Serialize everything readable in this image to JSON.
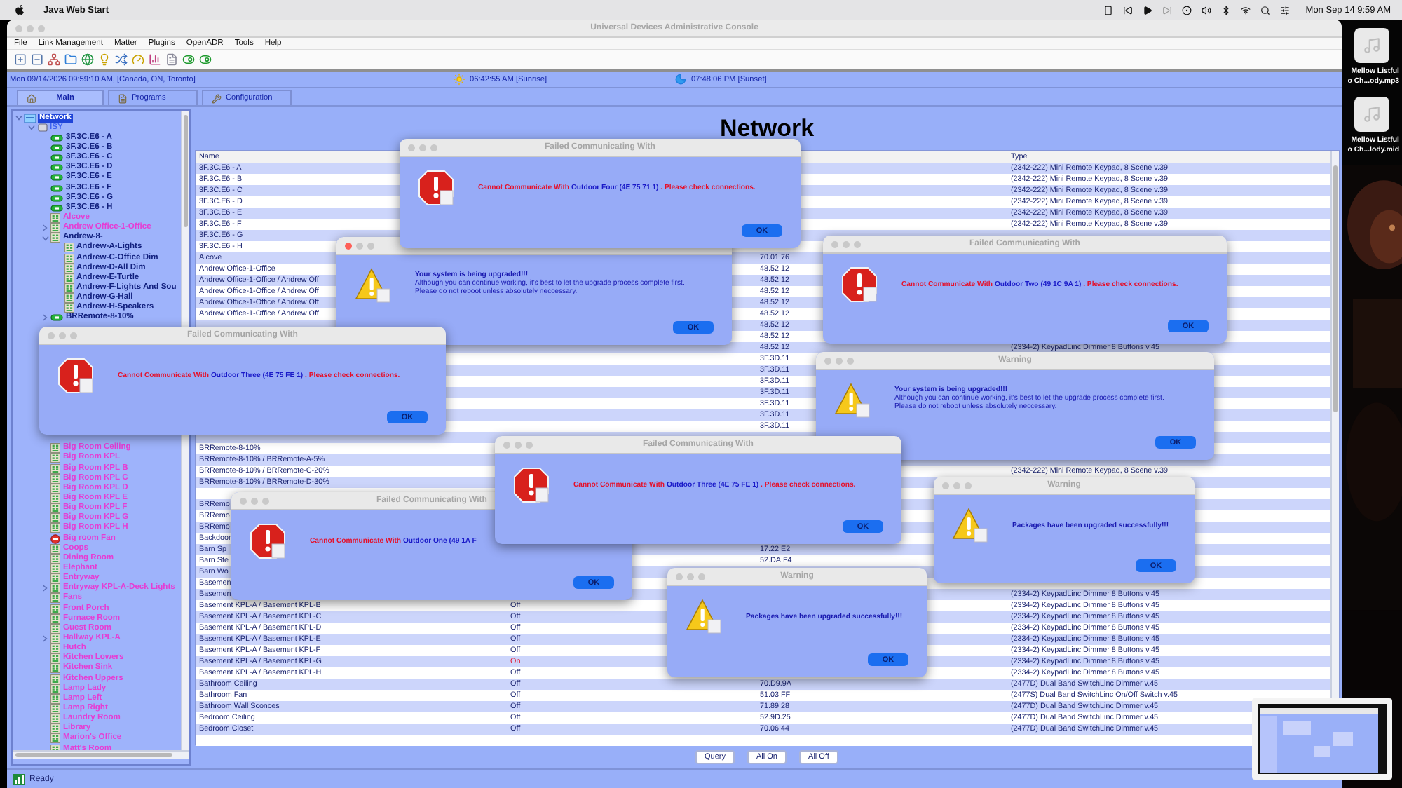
{
  "mac_menu_bar": {
    "app": "Java Web Start",
    "clock": "Mon Sep 14  9:59 AM"
  },
  "window": {
    "title": "Universal Devices Administrative Console"
  },
  "menu": [
    "File",
    "Link Management",
    "Matter",
    "Plugins",
    "OpenADR",
    "Tools",
    "Help"
  ],
  "info_bar": {
    "date": "Mon 09/14/2026 09:59:10 AM,  [Canada, ON, Toronto]",
    "sunrise": "06:42:55 AM [Sunrise]",
    "sunset": "07:48:06 PM [Sunset]"
  },
  "tabs": [
    {
      "label": "Main",
      "selected": true
    },
    {
      "label": "Programs",
      "selected": false
    },
    {
      "label": "Configuration",
      "selected": false
    }
  ],
  "sidebar": {
    "tree": [
      {
        "label": "Network",
        "kind": "network",
        "selected": true,
        "expanded": true,
        "children": [
          {
            "label": "ISY",
            "kind": "controller",
            "color": "#3f63f2",
            "selected": false,
            "expanded": true,
            "children": [
              {
                "label": "3F.3C.E6 - A",
                "kind": "remote",
                "color": "#12207e",
                "selected": false
              },
              {
                "label": "3F.3C.E6 - B",
                "kind": "remote",
                "color": "#12207e",
                "selected": false
              },
              {
                "label": "3F.3C.E6 - C",
                "kind": "remote",
                "color": "#12207e",
                "selected": false
              },
              {
                "label": "3F.3C.E6 - D",
                "kind": "remote",
                "color": "#12207e",
                "selected": false
              },
              {
                "label": "3F.3C.E6 - E",
                "kind": "remote",
                "color": "#12207e",
                "selected": false
              },
              {
                "label": "3F.3C.E6 - F",
                "kind": "remote",
                "color": "#12207e",
                "selected": false
              },
              {
                "label": "3F.3C.E6 - G",
                "kind": "remote",
                "color": "#12207e",
                "selected": false
              },
              {
                "label": "3F.3C.E6 - H",
                "kind": "remote",
                "color": "#12207e",
                "selected": false
              },
              {
                "label": "Alcove",
                "kind": "keypad",
                "color": "#e63cd4",
                "selected": false
              },
              {
                "label": "Andrew Office-1-Office",
                "kind": "keypad",
                "color": "#e63cd4",
                "selected": false,
                "expanded": false
              },
              {
                "label": "Andrew-8-",
                "kind": "keypad",
                "color": "#12207e",
                "selected": false,
                "expanded": true,
                "children": [
                  {
                    "label": "Andrew-A-Lights",
                    "kind": "keypad",
                    "color": "#12207e",
                    "selected": false
                  },
                  {
                    "label": "Andrew-C-Office Dim",
                    "kind": "keypad",
                    "color": "#12207e",
                    "selected": false
                  },
                  {
                    "label": "Andrew-D-All Dim",
                    "kind": "keypad",
                    "color": "#12207e",
                    "selected": false
                  },
                  {
                    "label": "Andrew-E-Turtle",
                    "kind": "keypad",
                    "color": "#12207e",
                    "selected": false
                  },
                  {
                    "label": "Andrew-F-Lights And Sou",
                    "kind": "keypad",
                    "color": "#12207e",
                    "selected": false
                  },
                  {
                    "label": "Andrew-G-Hall",
                    "kind": "keypad",
                    "color": "#12207e",
                    "selected": false
                  },
                  {
                    "label": "Andrew-H-Speakers",
                    "kind": "keypad",
                    "color": "#12207e",
                    "selected": false
                  }
                ]
              },
              {
                "label": "BRRemote-8-10%",
                "kind": "remote",
                "color": "#12207e",
                "selected": false,
                "expanded": false
              }
            ]
          }
        ]
      }
    ],
    "tree_continued": [
      {
        "label": "Big Room Ceiling",
        "kind": "keypad",
        "color": "#e63cd4",
        "selected": false
      },
      {
        "label": "Big Room KPL",
        "kind": "keypad",
        "color": "#e63cd4",
        "selected": false
      },
      {
        "label": "Big Room KPL B",
        "kind": "keypad",
        "color": "#e63cd4",
        "selected": false
      },
      {
        "label": "Big Room KPL C",
        "kind": "keypad",
        "color": "#e63cd4",
        "selected": false
      },
      {
        "label": "Big Room KPL D",
        "kind": "keypad",
        "color": "#e63cd4",
        "selected": false
      },
      {
        "label": "Big Room KPL E",
        "kind": "keypad",
        "color": "#e63cd4",
        "selected": false
      },
      {
        "label": "Big Room KPL F",
        "kind": "keypad",
        "color": "#e63cd4",
        "selected": false
      },
      {
        "label": "Big Room KPL G",
        "kind": "keypad",
        "color": "#e63cd4",
        "selected": false
      },
      {
        "label": "Big Room KPL H",
        "kind": "keypad",
        "color": "#e63cd4",
        "selected": false
      },
      {
        "label": "Big room Fan",
        "kind": "fault",
        "color": "#e63cd4",
        "selected": false
      },
      {
        "label": "Coops",
        "kind": "keypad",
        "color": "#e63cd4",
        "selected": false
      },
      {
        "label": "Dining Room",
        "kind": "keypad",
        "color": "#e63cd4",
        "selected": false
      },
      {
        "label": "Elephant",
        "kind": "keypad",
        "color": "#e63cd4",
        "selected": false
      },
      {
        "label": "Entryway",
        "kind": "keypad",
        "color": "#e63cd4",
        "selected": false
      },
      {
        "label": "Entryway KPL-A-Deck Lights",
        "kind": "keypad",
        "color": "#e63cd4",
        "selected": false,
        "expanded": false
      },
      {
        "label": "Fans",
        "kind": "keypad",
        "color": "#e63cd4",
        "selected": false
      },
      {
        "label": "Front Porch",
        "kind": "keypad",
        "color": "#e63cd4",
        "selected": false
      },
      {
        "label": "Furnace Room",
        "kind": "keypad",
        "color": "#e63cd4",
        "selected": false
      },
      {
        "label": "Guest Room",
        "kind": "keypad",
        "color": "#e63cd4",
        "selected": false
      },
      {
        "label": "Hallway KPL-A",
        "kind": "keypad",
        "color": "#e63cd4",
        "selected": false,
        "expanded": false
      },
      {
        "label": "Hutch",
        "kind": "keypad",
        "color": "#e63cd4",
        "selected": false
      },
      {
        "label": "Kitchen Lowers",
        "kind": "keypad",
        "color": "#e63cd4",
        "selected": false
      },
      {
        "label": "Kitchen Sink",
        "kind": "keypad",
        "color": "#e63cd4",
        "selected": false
      },
      {
        "label": "Kitchen Uppers",
        "kind": "keypad",
        "color": "#e63cd4",
        "selected": false
      },
      {
        "label": "Lamp Lady",
        "kind": "keypad",
        "color": "#e63cd4",
        "selected": false
      },
      {
        "label": "Lamp Left",
        "kind": "keypad",
        "color": "#e63cd4",
        "selected": false
      },
      {
        "label": "Lamp Right",
        "kind": "keypad",
        "color": "#e63cd4",
        "selected": false
      },
      {
        "label": "Laundry Room",
        "kind": "keypad",
        "color": "#e63cd4",
        "selected": false
      },
      {
        "label": "Library",
        "kind": "keypad",
        "color": "#e63cd4",
        "selected": false
      },
      {
        "label": "Marion's Office",
        "kind": "keypad",
        "color": "#e63cd4",
        "selected": false
      },
      {
        "label": "Matt's Room",
        "kind": "keypad",
        "color": "#e63cd4",
        "selected": false
      }
    ]
  },
  "content": {
    "heading": "Network",
    "table": {
      "header": {
        "name": "Name",
        "type": "Type"
      },
      "rows": [
        {
          "name": "3F.3C.E6 - A",
          "type": "(2342-222) Mini Remote Keypad, 8 Scene v.39"
        },
        {
          "name": "3F.3C.E6 - B",
          "type": "(2342-222) Mini Remote Keypad, 8 Scene v.39"
        },
        {
          "name": "3F.3C.E6 - C",
          "type": "(2342-222) Mini Remote Keypad, 8 Scene v.39"
        },
        {
          "name": "3F.3C.E6 - D",
          "type": "(2342-222) Mini Remote Keypad, 8 Scene v.39"
        },
        {
          "name": "3F.3C.E6 - E",
          "type": "(2342-222) Mini Remote Keypad, 8 Scene v.39"
        },
        {
          "name": "3F.3C.E6 - F",
          "type": "(2342-222) Mini Remote Keypad, 8 Scene v.39"
        },
        {
          "name": "3F.3C.E6 - G"
        },
        {
          "name": "3F.3C.E6 - H"
        },
        {
          "name": "Alcove",
          "address": "70.01.76"
        },
        {
          "name": "Andrew Office-1-Office",
          "address": "48.52.12"
        },
        {
          "name": "Andrew Office-1-Office / Andrew Off",
          "address": "48.52.12"
        },
        {
          "name": "Andrew Office-1-Office / Andrew Off",
          "address": "48.52.12"
        },
        {
          "name": "Andrew Office-1-Office / Andrew Off",
          "address": "48.52.12"
        },
        {
          "name": "Andrew Office-1-Office / Andrew Off",
          "address": "48.52.12"
        },
        {
          "address": "48.52.12"
        },
        {
          "address": "48.52.12"
        },
        {
          "address": "48.52.12",
          "type": "(2334-2) KeypadLinc Dimmer 8 Buttons v.45"
        },
        {
          "address": "3F.3D.11"
        },
        {
          "address": "3F.3D.11"
        },
        {
          "address": "3F.3D.11"
        },
        {
          "address": "3F.3D.11"
        },
        {
          "address": "3F.3D.11"
        },
        {
          "address": "3F.3D.11"
        },
        {
          "address": "3F.3D.11"
        },
        {},
        {
          "name": "BRRemote-8-10%"
        },
        {
          "name": "BRRemote-8-10% / BRRemote-A-5%"
        },
        {
          "name": "BRRemote-8-10% / BRRemote-C-20%",
          "type": "(2342-222) Mini Remote Keypad, 8 Scene v.39"
        },
        {
          "name": "BRRemote-8-10% / BRRemote-D-30%"
        },
        {},
        {
          "name": "BRRemo"
        },
        {
          "name": "BRRemo"
        },
        {
          "name": "BRRemo"
        },
        {
          "name": "Backdoor"
        },
        {
          "name": "Barn Sp",
          "address": "17.22.E2"
        },
        {
          "name": "Barn Ste",
          "address": "52.DA.F4"
        },
        {
          "name": "Barn Wo"
        },
        {
          "name": "Basemen"
        },
        {
          "name": "Basemen",
          "type": "(2334-2) KeypadLinc Dimmer 8 Buttons v.45"
        },
        {
          "name": "Basement KPL-A / Basement KPL-B",
          "status": "Off",
          "on": false,
          "type": "(2334-2) KeypadLinc Dimmer 8 Buttons v.45"
        },
        {
          "name": "Basement KPL-A / Basement KPL-C",
          "status": "Off",
          "on": false,
          "type": "(2334-2) KeypadLinc Dimmer 8 Buttons v.45"
        },
        {
          "name": "Basement KPL-A / Basement KPL-D",
          "status": "Off",
          "on": false,
          "type": "(2334-2) KeypadLinc Dimmer 8 Buttons v.45"
        },
        {
          "name": "Basement KPL-A / Basement KPL-E",
          "status": "Off",
          "on": false,
          "type": "(2334-2) KeypadLinc Dimmer 8 Buttons v.45"
        },
        {
          "name": "Basement KPL-A / Basement KPL-F",
          "status": "Off",
          "on": false,
          "type": "(2334-2) KeypadLinc Dimmer 8 Buttons v.45"
        },
        {
          "name": "Basement KPL-A / Basement KPL-G",
          "status": "On",
          "on": true,
          "type": "(2334-2) KeypadLinc Dimmer 8 Buttons v.45"
        },
        {
          "name": "Basement KPL-A / Basement KPL-H",
          "status": "Off",
          "on": false,
          "type": "(2334-2) KeypadLinc Dimmer 8 Buttons v.45"
        },
        {
          "name": "Bathroom Ceiling",
          "status": "Off",
          "on": false,
          "address": "70.D9.9A",
          "type": "(2477D) Dual Band SwitchLinc Dimmer v.45"
        },
        {
          "name": "Bathroom Fan",
          "status": "Off",
          "on": false,
          "address": "51.03.FF",
          "type": "(2477S) Dual Band SwitchLinc On/Off Switch v.45"
        },
        {
          "name": "Bathroom Wall Sconces",
          "status": "Off",
          "on": false,
          "address": "71.89.28",
          "type": "(2477D) Dual Band SwitchLinc Dimmer v.45"
        },
        {
          "name": "Bedroom Ceiling",
          "status": "Off",
          "on": false,
          "address": "52.9D.25",
          "type": "(2477D) Dual Band SwitchLinc Dimmer v.45"
        },
        {
          "name": "Bedroom Closet",
          "status": "Off",
          "on": false,
          "address": "70.06.44",
          "type": "(2477D) Dual Band SwitchLinc Dimmer v.45"
        }
      ]
    },
    "buttons": [
      "Query",
      "All On",
      "All Off"
    ]
  },
  "status_bar": "Ready",
  "dialogs": [
    {
      "kind": "warning",
      "focused": true,
      "heading": "Your system is being upgraded!!!",
      "lines": [
        "Although you can continue working, it's best to let the upgrade process complete first.",
        "Please do not reboot unless absolutely neccessary."
      ],
      "ok": "OK"
    },
    {
      "kind": "error",
      "focused": false,
      "title": "Failed Communicating With",
      "lead": "Cannot Communicate With",
      "device": "Outdoor Four (4E 75 71 1)",
      "tail": ". Please check connections.",
      "ok": "OK"
    },
    {
      "kind": "error",
      "focused": false,
      "title": "Failed Communicating With",
      "lead": "Cannot Communicate With",
      "device": "Outdoor Three (4E 75 FE 1)",
      "tail": ". Please check connections.",
      "ok": "OK"
    },
    {
      "kind": "error",
      "focused": false,
      "title": "Failed Communicating With",
      "lead": "Cannot Communicate With",
      "device": "Outdoor Two (49 1C 9A 1)",
      "tail": ". Please check connections.",
      "ok": "OK"
    },
    {
      "kind": "warning",
      "focused": false,
      "title": "Warning",
      "heading": "Your system is being upgraded!!!",
      "lines": [
        "Although you can continue working, it's best to let the upgrade process complete first.",
        "Please do not reboot unless absolutely neccessary."
      ],
      "ok": "OK"
    },
    {
      "kind": "error",
      "focused": false,
      "title": "Failed Communicating With",
      "lead": "Cannot Communicate With",
      "device": "Outdoor One (49 1A F",
      "ok": "OK"
    },
    {
      "kind": "error",
      "focused": false,
      "title": "Failed Communicating With",
      "lead": "Cannot Communicate With",
      "device": "Outdoor Three (4E 75 FE 1)",
      "tail": ". Please check connections.",
      "ok": "OK"
    },
    {
      "kind": "warning",
      "focused": false,
      "title": "Warning",
      "heading": "Packages have been upgraded successfully!!!",
      "ok": "OK"
    },
    {
      "kind": "warning",
      "focused": false,
      "title": "Warning",
      "heading": "Packages have been upgraded successfully!!!",
      "ok": "OK"
    }
  ],
  "desktop": {
    "files": [
      {
        "lines": [
          "Mellow Listful",
          "o Ch...ody.mp3"
        ]
      },
      {
        "lines": [
          "Mellow Listful",
          "o Ch...lody.mid"
        ]
      }
    ]
  }
}
